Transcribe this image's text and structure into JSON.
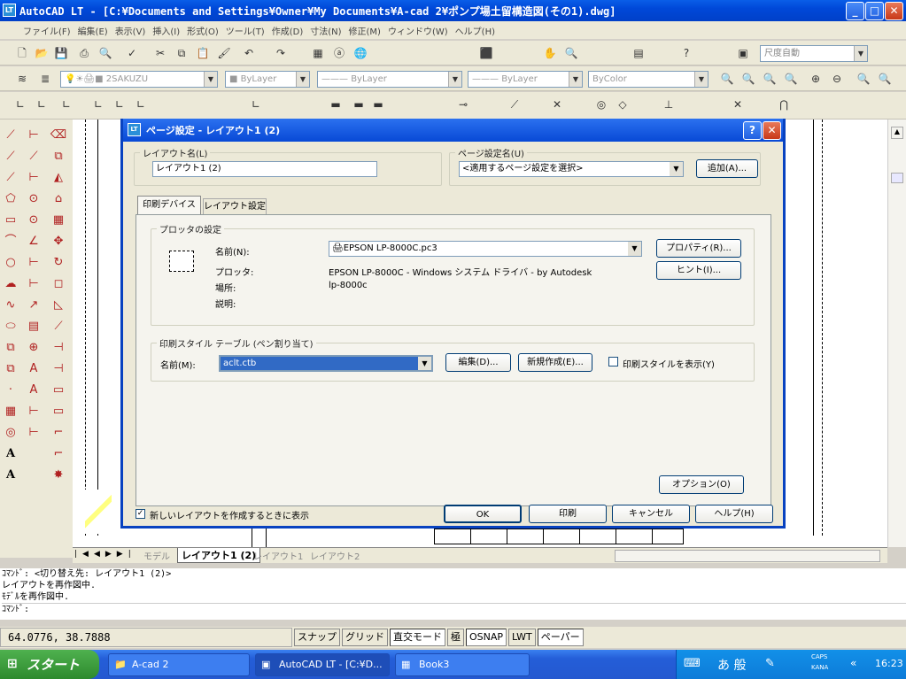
{
  "window": {
    "title": "AutoCAD LT - [C:¥Documents and Settings¥Owner¥My Documents¥A-cad 2¥ポンプ場土留構造図(その1).dwg]",
    "icon": "LT"
  },
  "menu": [
    "ファイル(F)",
    "編集(E)",
    "表示(V)",
    "挿入(I)",
    "形式(O)",
    "ツール(T)",
    "作成(D)",
    "寸法(N)",
    "修正(M)",
    "ウィンドウ(W)",
    "ヘルプ(H)"
  ],
  "toolbar": {
    "dimstyle": "尺度自動",
    "layer": "2SAKUZU",
    "linetype1": "ByLayer",
    "linetype2": "ByLayer",
    "linetype3": "ByLayer",
    "color": "ByColor"
  },
  "dialog": {
    "title": "ページ設定 - レイアウト1 (2)",
    "help_icon": "?",
    "layout_group": "レイアウト名(L)",
    "layout_value": "レイアウト1 (2)",
    "pagesetup_group": "ページ設定名(U)",
    "pagesetup_value": "<適用するページ設定を選択>",
    "add_button": "追加(A)...",
    "tabs": [
      "印刷デバイス",
      "レイアウト設定"
    ],
    "plotter_group": "プロッタの設定",
    "name_label": "名前(N):",
    "plotter_value": "EPSON LP-8000C.pc3",
    "properties_button": "プロパティ(R)...",
    "hint_button": "ヒント(I)...",
    "plotter_label": "プロッタ:",
    "plotter_desc": "EPSON LP-8000C - Windows システム ドライバ - by Autodesk",
    "location_label": "場所:",
    "location_value": "lp-8000c",
    "description_label": "説明:",
    "style_group": "印刷スタイル テーブル (ペン割り当て)",
    "style_name_label": "名前(M):",
    "style_value": "aclt.ctb",
    "edit_button": "編集(D)...",
    "new_button": "新規作成(E)...",
    "show_styles_label": "印刷スタイルを表示(Y)",
    "options_button": "オプション(O)",
    "new_layout_label": "新しいレイアウトを作成するときに表示",
    "ok_button": "OK",
    "print_button": "印刷",
    "cancel_button": "キャンセル",
    "helpbtn": "ヘルプ(H)"
  },
  "layout_tabs": [
    "モデル",
    "レイアウト1 (2)",
    "レイアウト1",
    "レイアウト2"
  ],
  "command_lines": [
    "ｺﾏﾝﾄﾞ:  <切り替え先: レイアウト1 (2)>",
    "レイアウトを再作図中.",
    "ﾓﾃﾞﾙを再作図中.",
    "ｺﾏﾝﾄﾞ:"
  ],
  "status": {
    "coords": "64.0776, 38.7888",
    "buttons": [
      "スナップ",
      "グリッド",
      "直交モード",
      "極",
      "OSNAP",
      "LWT",
      "ペーパー"
    ]
  },
  "taskbar": {
    "start": "スタート",
    "tasks": [
      "A-cad 2",
      "AutoCAD LT - [C:¥D...",
      "Book3"
    ],
    "ime": "あ 般",
    "caps": "CAPS",
    "kana": "KANA",
    "clock": "16:23"
  }
}
